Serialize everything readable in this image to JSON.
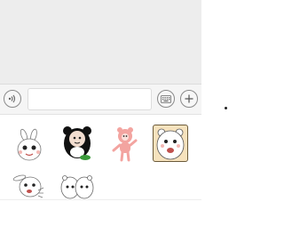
{
  "chat": {
    "message_input": {
      "value": "",
      "placeholder": ""
    },
    "voice_button_icon": "voice-icon",
    "keyboard_button_icon": "keyboard-icon",
    "plus_button_icon": "plus-icon"
  },
  "sticker_panel": {
    "stickers": [
      {
        "name": "panda-bunny-sticker",
        "selected": false
      },
      {
        "name": "panda-suit-sticker",
        "selected": false
      },
      {
        "name": "pink-bear-sticker",
        "selected": false
      },
      {
        "name": "white-baby-sticker",
        "selected": true
      },
      {
        "name": "running-bunny-sticker",
        "selected": false
      },
      {
        "name": "two-babies-sticker",
        "selected": false
      }
    ]
  },
  "colors": {
    "chat_background": "#ededed",
    "input_bar_background": "#f5f5f5",
    "selected_sticker_background": "#f6e2bd"
  }
}
